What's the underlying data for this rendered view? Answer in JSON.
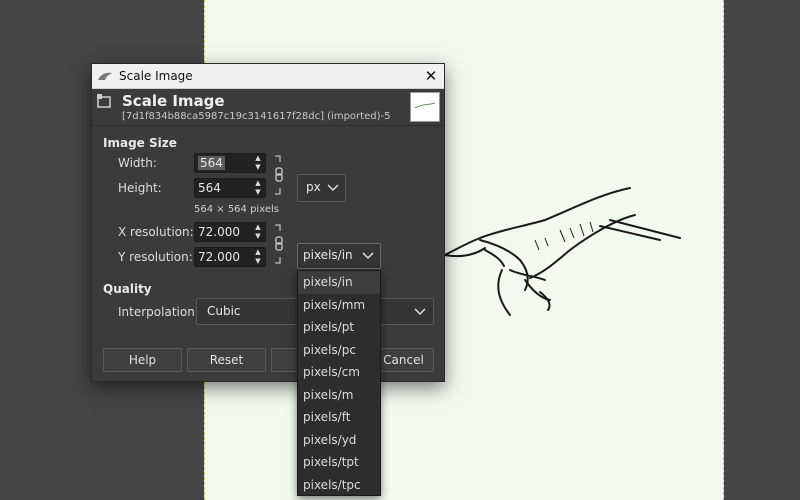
{
  "dialog": {
    "window_title": "Scale Image",
    "header_title": "Scale Image",
    "header_subtitle": "[7d1f834b88ca5987c19c3141617f28dc] (imported)-5",
    "close_glyph": "✕"
  },
  "image_size": {
    "section_label": "Image Size",
    "width_label": "Width:",
    "width_value": "564",
    "height_label": "Height:",
    "height_value": "564",
    "pixel_info": "564 × 564 pixels",
    "size_unit": "px",
    "xres_label": "X resolution:",
    "xres_value": "72.000",
    "yres_label": "Y resolution:",
    "yres_value": "72.000",
    "res_unit": "pixels/in"
  },
  "quality": {
    "section_label": "Quality",
    "interp_label": "Interpolation:",
    "interp_value": "Cubic"
  },
  "buttons": {
    "help": "Help",
    "reset": "Reset",
    "cancel": "Cancel"
  },
  "unit_menu": {
    "items": [
      "pixels/in",
      "pixels/mm",
      "pixels/pt",
      "pixels/pc",
      "pixels/cm",
      "pixels/m",
      "pixels/ft",
      "pixels/yd",
      "pixels/tpt",
      "pixels/tpc"
    ],
    "selected": "pixels/in"
  },
  "icons": {
    "app": "wilber-icon",
    "header": "scale-image-icon",
    "chain": "chain-link-icon",
    "spin": "spin-arrows-icon",
    "dropdown": "chevron-down-icon"
  },
  "colors": {
    "canvas_bg": "#454545",
    "image_bg": "#f3f9f1",
    "dialog_bg": "#3b3b3b",
    "menu_bg": "#2d2d2d"
  }
}
